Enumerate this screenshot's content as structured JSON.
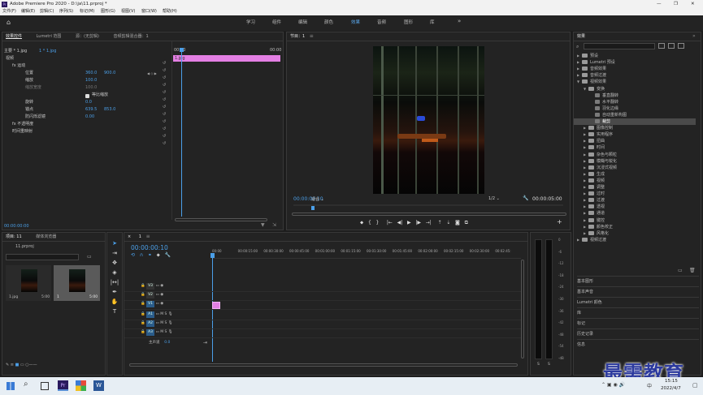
{
  "window": {
    "title": "Adobe Premiere Pro 2020 - D:\\ja\\11.prproj *",
    "controls": [
      "—",
      "❐",
      "✕"
    ]
  },
  "menu": [
    "文件(F)",
    "编辑(E)",
    "剪辑(C)",
    "序列(S)",
    "标记(M)",
    "图形(G)",
    "视图(V)",
    "窗口(W)",
    "帮助(H)"
  ],
  "workspaces": [
    "学习",
    "组件",
    "编辑",
    "颜色",
    "效果",
    "音频",
    "图形",
    "库"
  ],
  "workspace_active": "效果",
  "effect_controls": {
    "tabs": [
      "效果控件",
      "Lumetri 范围",
      "源：(无剪辑)",
      "音频剪辑混合器：1"
    ],
    "master": "主要 * 1.jpg",
    "clip": "1 * 1.jpg",
    "time_start": "00:00",
    "time_end": "00:00",
    "clip_label": "1.jpg",
    "section_video": "视频",
    "rows": [
      {
        "label": "fx 运动"
      },
      {
        "label": "位置",
        "v1": "360.0",
        "v2": "900.0"
      },
      {
        "label": "缩放",
        "v1": "100.0"
      },
      {
        "label": "缩放宽度",
        "v1": "100.0"
      },
      {
        "label": "等比缩放"
      },
      {
        "label": "旋转",
        "v1": "0.0"
      },
      {
        "label": "锚点",
        "v1": "639.5",
        "v2": "853.0"
      },
      {
        "label": "防闪烁滤镜",
        "v1": "0.00"
      },
      {
        "label": "fx 不透明度"
      },
      {
        "label": "时间重映射"
      }
    ],
    "timecode": "00:00:00:00"
  },
  "program": {
    "tab": "节目：1",
    "timecode": "00:00:00:10",
    "fit": "适合",
    "ratio": "1/2",
    "duration": "00:00:05:00"
  },
  "effects_panel": {
    "tab": "效果",
    "items": [
      {
        "label": "预设",
        "level": 0,
        "open": false
      },
      {
        "label": "Lumetri 预设",
        "level": 0,
        "open": false
      },
      {
        "label": "音频效果",
        "level": 0,
        "open": false
      },
      {
        "label": "音频过渡",
        "level": 0,
        "open": false
      },
      {
        "label": "视频效果",
        "level": 0,
        "open": true
      },
      {
        "label": "变换",
        "level": 1,
        "open": true
      },
      {
        "label": "垂直翻转",
        "level": 2,
        "fx": true
      },
      {
        "label": "水平翻转",
        "level": 2,
        "fx": true
      },
      {
        "label": "羽化边缘",
        "level": 2,
        "fx": true
      },
      {
        "label": "自动重新构图",
        "level": 2,
        "fx": true
      },
      {
        "label": "裁剪",
        "level": 2,
        "fx": true,
        "selected": true
      },
      {
        "label": "图像控制",
        "level": 1
      },
      {
        "label": "实用程序",
        "level": 1
      },
      {
        "label": "扭曲",
        "level": 1
      },
      {
        "label": "时间",
        "level": 1
      },
      {
        "label": "杂色与颗粒",
        "level": 1
      },
      {
        "label": "模糊与锐化",
        "level": 1
      },
      {
        "label": "沉浸式视频",
        "level": 1
      },
      {
        "label": "生成",
        "level": 1
      },
      {
        "label": "视频",
        "level": 1
      },
      {
        "label": "调整",
        "level": 1
      },
      {
        "label": "过时",
        "level": 1
      },
      {
        "label": "过渡",
        "level": 1
      },
      {
        "label": "透视",
        "level": 1
      },
      {
        "label": "通道",
        "level": 1
      },
      {
        "label": "键控",
        "level": 1
      },
      {
        "label": "颜色校正",
        "level": 1
      },
      {
        "label": "风格化",
        "level": 1
      },
      {
        "label": "视频过渡",
        "level": 0,
        "open": false
      }
    ],
    "panels": [
      "基本图形",
      "基本声音",
      "Lumetri 颜色",
      "库",
      "标记",
      "历史记录",
      "信息"
    ]
  },
  "project": {
    "tabs": [
      "项目: 11",
      "媒体浏览器"
    ],
    "file": "11.prproj",
    "items": [
      {
        "name": "1.jpg",
        "dur": "5:00"
      },
      {
        "name": "1",
        "dur": "5:00"
      }
    ]
  },
  "timeline": {
    "tab": "1",
    "timecode": "00:00:00:10",
    "ruler": [
      "00:00",
      "00:00:15:00",
      "00:00:30:00",
      "00:00:45:00",
      "00:01:00:00",
      "00:01:15:00",
      "00:01:30:00",
      "00:01:45:00",
      "00:02:00:00",
      "00:02:15:00",
      "00:02:30:00",
      "00:02:45:"
    ],
    "video_tracks": [
      "V3",
      "V2",
      "V1"
    ],
    "audio_tracks": [
      "A1",
      "A2",
      "A3"
    ],
    "master": "主声道",
    "master_val": "0.0"
  },
  "meter": {
    "labels": [
      "0",
      "-6",
      "-12",
      "-18",
      "-24",
      "-30",
      "-36",
      "-42",
      "-48",
      "-54",
      "-dB"
    ],
    "bottom": [
      "S",
      "S"
    ]
  },
  "taskbar": {
    "time": "15:15",
    "date": "2022/4/7",
    "ime": "中"
  },
  "watermark": "最需教育",
  "colors": {
    "accent": "#4b9fe8",
    "clip": "#e37fe3",
    "workspace_active": "#5aa7ea"
  }
}
